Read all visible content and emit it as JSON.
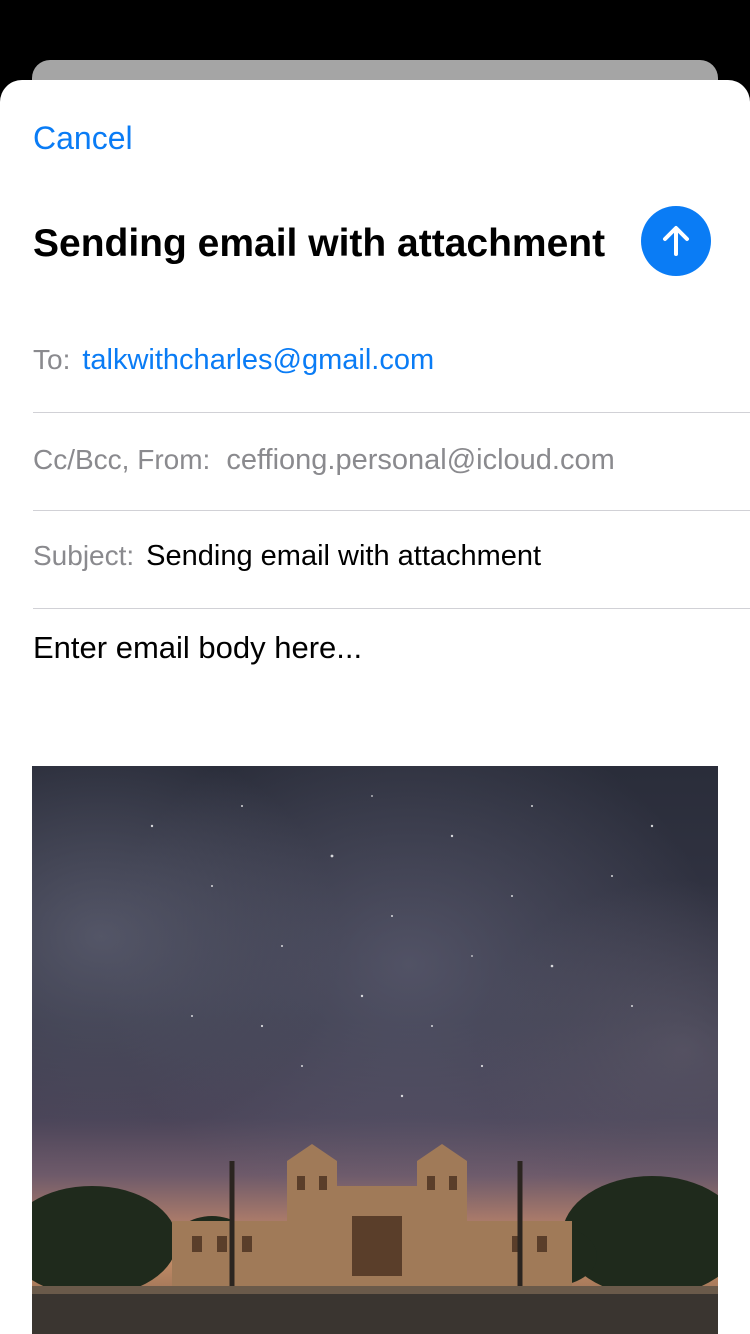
{
  "compose": {
    "cancel_label": "Cancel",
    "title": "Sending email with attachment",
    "to_label": "To:",
    "to_value": "talkwithcharles@gmail.com",
    "cc_from_label": "Cc/Bcc, From:",
    "from_value": "ceffiong.personal@icloud.com",
    "subject_label": "Subject:",
    "subject_value": "Sending email with attachment",
    "body_text": "Enter email body here..."
  },
  "attachment": {
    "type": "image",
    "description_icon": "photo-attachment"
  },
  "colors": {
    "accent": "#0a7cf5",
    "label_gray": "#8a8a8e",
    "divider": "#d1d1d6",
    "background": "#000000",
    "sheet": "#ffffff"
  }
}
